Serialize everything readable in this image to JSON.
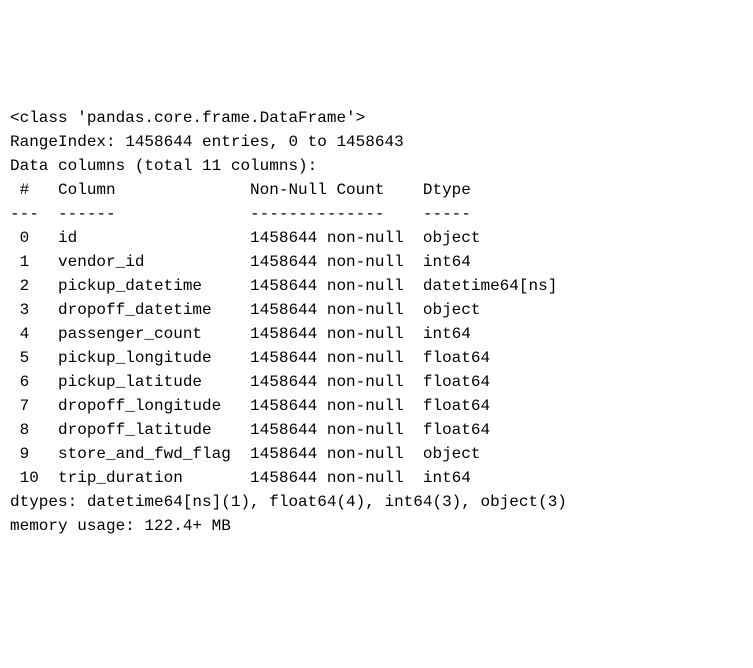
{
  "header": {
    "class_line": "<class 'pandas.core.frame.DataFrame'>",
    "range_index": "RangeIndex: 1458644 entries, 0 to 1458643",
    "data_columns": "Data columns (total 11 columns):"
  },
  "table_header": {
    "idx": " #  ",
    "column": " Column             ",
    "nonnull": " Non-Null Count   ",
    "dtype": " Dtype         "
  },
  "table_divider": {
    "idx": "--- ",
    "column": " ------             ",
    "nonnull": " --------------   ",
    "dtype": " -----         "
  },
  "columns": [
    {
      "idx": " 0  ",
      "name": " id                 ",
      "nonnull": " 1458644 non-null ",
      "dtype": " object        "
    },
    {
      "idx": " 1  ",
      "name": " vendor_id          ",
      "nonnull": " 1458644 non-null ",
      "dtype": " int64         "
    },
    {
      "idx": " 2  ",
      "name": " pickup_datetime    ",
      "nonnull": " 1458644 non-null ",
      "dtype": " datetime64[ns]"
    },
    {
      "idx": " 3  ",
      "name": " dropoff_datetime   ",
      "nonnull": " 1458644 non-null ",
      "dtype": " object        "
    },
    {
      "idx": " 4  ",
      "name": " passenger_count    ",
      "nonnull": " 1458644 non-null ",
      "dtype": " int64         "
    },
    {
      "idx": " 5  ",
      "name": " pickup_longitude   ",
      "nonnull": " 1458644 non-null ",
      "dtype": " float64       "
    },
    {
      "idx": " 6  ",
      "name": " pickup_latitude    ",
      "nonnull": " 1458644 non-null ",
      "dtype": " float64       "
    },
    {
      "idx": " 7  ",
      "name": " dropoff_longitude  ",
      "nonnull": " 1458644 non-null ",
      "dtype": " float64       "
    },
    {
      "idx": " 8  ",
      "name": " dropoff_latitude   ",
      "nonnull": " 1458644 non-null ",
      "dtype": " float64       "
    },
    {
      "idx": " 9  ",
      "name": " store_and_fwd_flag ",
      "nonnull": " 1458644 non-null ",
      "dtype": " object        "
    },
    {
      "idx": " 10 ",
      "name": " trip_duration      ",
      "nonnull": " 1458644 non-null ",
      "dtype": " int64         "
    }
  ],
  "footer": {
    "dtypes": "dtypes: datetime64[ns](1), float64(4), int64(3), object(3)",
    "memory": "memory usage: 122.4+ MB"
  }
}
